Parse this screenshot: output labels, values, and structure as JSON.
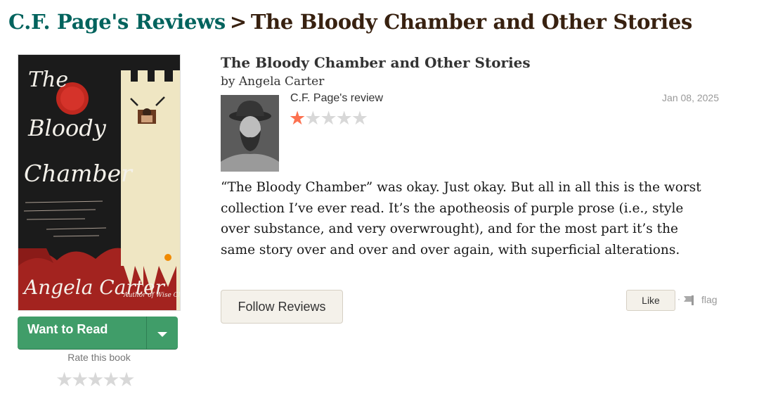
{
  "breadcrumb": {
    "link": "C.F. Page's Reviews",
    "separator": ">",
    "current": "The Bloody Chamber and Other Stories"
  },
  "book": {
    "title": "The Bloody Chamber and Other Stories",
    "by": "by",
    "author": "Angela Carter",
    "cover": {
      "title_line1": "The",
      "title_line2": "Bloody",
      "title_line3": "Chamber",
      "author": "Angela Carter",
      "tagline": "Author of Wise Children"
    }
  },
  "shelf": {
    "button_label": "Want to Read",
    "rate_label": "Rate this book",
    "rate_stars": 5
  },
  "review": {
    "reviewer_name": "C.F. Page's",
    "reviewer_suffix": " review",
    "date": "Jan 08, 2025",
    "rating": 1,
    "rating_max": 5,
    "text": "“The Bloody Chamber” was okay. Just okay. But all in all this is the worst collection I’ve ever read. It’s the apotheosis of purple prose (i.e., style over substance, and very overwrought), and for the most part it’s the same story over and over and over again, with superficial alterations."
  },
  "actions": {
    "follow_label": "Follow Reviews",
    "like_label": "Like",
    "separator": "·",
    "flag_label": "flag"
  },
  "colors": {
    "breadcrumb_link": "#00635d",
    "breadcrumb_title": "#382110",
    "want_to_read": "#409d69",
    "star_on": "#fc7150",
    "star_off": "#d8d8d8"
  }
}
